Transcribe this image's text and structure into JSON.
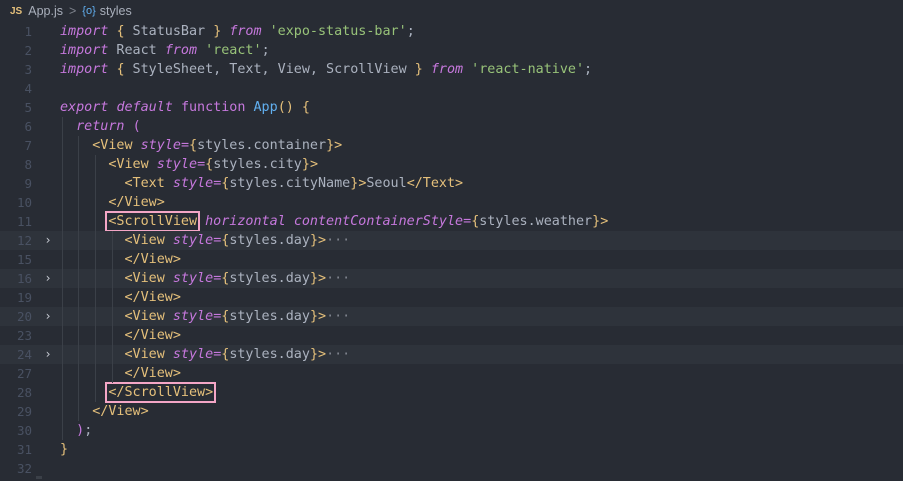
{
  "breadcrumb": {
    "lang_badge": "JS",
    "file": "App.js",
    "separator": ">",
    "symbol_icon": "{o}",
    "symbol": "styles"
  },
  "lines": [
    {
      "n": "1",
      "tokens": [
        [
          "kw",
          "import"
        ],
        [
          "plain",
          " "
        ],
        [
          "br2",
          "{"
        ],
        [
          "plain",
          " StatusBar "
        ],
        [
          "br2",
          "}"
        ],
        [
          "plain",
          " "
        ],
        [
          "kw",
          "from"
        ],
        [
          "plain",
          " "
        ],
        [
          "str",
          "'expo-status-bar'"
        ],
        [
          "plain",
          ";"
        ]
      ]
    },
    {
      "n": "2",
      "tokens": [
        [
          "kw",
          "import"
        ],
        [
          "plain",
          " React "
        ],
        [
          "kw",
          "from"
        ],
        [
          "plain",
          " "
        ],
        [
          "str",
          "'react'"
        ],
        [
          "plain",
          ";"
        ]
      ]
    },
    {
      "n": "3",
      "tokens": [
        [
          "kw",
          "import"
        ],
        [
          "plain",
          " "
        ],
        [
          "br2",
          "{"
        ],
        [
          "plain",
          " StyleSheet, Text, View, ScrollView "
        ],
        [
          "br2",
          "}"
        ],
        [
          "plain",
          " "
        ],
        [
          "kw",
          "from"
        ],
        [
          "plain",
          " "
        ],
        [
          "str",
          "'react-native'"
        ],
        [
          "plain",
          ";"
        ]
      ]
    },
    {
      "n": "4",
      "tokens": []
    },
    {
      "n": "5",
      "tokens": [
        [
          "kw",
          "export"
        ],
        [
          "plain",
          " "
        ],
        [
          "kw",
          "default"
        ],
        [
          "plain",
          " "
        ],
        [
          "brk",
          "function"
        ],
        [
          "plain",
          " "
        ],
        [
          "fn",
          "App"
        ],
        [
          "br2",
          "()"
        ],
        [
          "plain",
          " "
        ],
        [
          "br2",
          "{"
        ]
      ]
    },
    {
      "n": "6",
      "tokens": [
        [
          "plain",
          "  "
        ],
        [
          "kw",
          "return"
        ],
        [
          "plain",
          " "
        ],
        [
          "brk",
          "("
        ]
      ]
    },
    {
      "n": "7",
      "tokens": [
        [
          "plain",
          "    "
        ],
        [
          "tag",
          "<View"
        ],
        [
          "plain",
          " "
        ],
        [
          "attr",
          "style"
        ],
        [
          "brk",
          "="
        ],
        [
          "br2",
          "{"
        ],
        [
          "plain",
          "styles.container"
        ],
        [
          "br2",
          "}"
        ],
        [
          "tag",
          ">"
        ]
      ]
    },
    {
      "n": "8",
      "tokens": [
        [
          "plain",
          "      "
        ],
        [
          "tag",
          "<View"
        ],
        [
          "plain",
          " "
        ],
        [
          "attr",
          "style"
        ],
        [
          "brk",
          "="
        ],
        [
          "br2",
          "{"
        ],
        [
          "plain",
          "styles.city"
        ],
        [
          "br2",
          "}"
        ],
        [
          "tag",
          ">"
        ]
      ]
    },
    {
      "n": "9",
      "tokens": [
        [
          "plain",
          "        "
        ],
        [
          "tag",
          "<Text"
        ],
        [
          "plain",
          " "
        ],
        [
          "attr",
          "style"
        ],
        [
          "brk",
          "="
        ],
        [
          "br2",
          "{"
        ],
        [
          "plain",
          "styles.cityName"
        ],
        [
          "br2",
          "}"
        ],
        [
          "tag",
          ">"
        ],
        [
          "plain",
          "Seoul"
        ],
        [
          "tag",
          "</Text>"
        ]
      ]
    },
    {
      "n": "10",
      "tokens": [
        [
          "plain",
          "      "
        ],
        [
          "tag",
          "</View>"
        ]
      ]
    },
    {
      "n": "11",
      "tokens": [
        [
          "plain",
          "      "
        ],
        [
          "box",
          "<ScrollView"
        ],
        [
          "plain",
          " "
        ],
        [
          "attr",
          "horizontal"
        ],
        [
          "plain",
          " "
        ],
        [
          "attr",
          "contentContainerStyle"
        ],
        [
          "brk",
          "="
        ],
        [
          "br2",
          "{"
        ],
        [
          "plain",
          "styles.weather"
        ],
        [
          "br2",
          "}"
        ],
        [
          "tag",
          ">"
        ]
      ]
    },
    {
      "n": "12",
      "fold": true,
      "tokens": [
        [
          "plain",
          "        "
        ],
        [
          "tag",
          "<View"
        ],
        [
          "plain",
          " "
        ],
        [
          "attr",
          "style"
        ],
        [
          "brk",
          "="
        ],
        [
          "br2",
          "{"
        ],
        [
          "plain",
          "styles.day"
        ],
        [
          "br2",
          "}"
        ],
        [
          "tag",
          ">"
        ],
        [
          "ell",
          "···"
        ]
      ]
    },
    {
      "n": "15",
      "tokens": [
        [
          "plain",
          "        "
        ],
        [
          "tag",
          "</View>"
        ]
      ]
    },
    {
      "n": "16",
      "fold": true,
      "tokens": [
        [
          "plain",
          "        "
        ],
        [
          "tag",
          "<View"
        ],
        [
          "plain",
          " "
        ],
        [
          "attr",
          "style"
        ],
        [
          "brk",
          "="
        ],
        [
          "br2",
          "{"
        ],
        [
          "plain",
          "styles.day"
        ],
        [
          "br2",
          "}"
        ],
        [
          "tag",
          ">"
        ],
        [
          "ell",
          "···"
        ]
      ]
    },
    {
      "n": "19",
      "tokens": [
        [
          "plain",
          "        "
        ],
        [
          "tag",
          "</View>"
        ]
      ]
    },
    {
      "n": "20",
      "fold": true,
      "tokens": [
        [
          "plain",
          "        "
        ],
        [
          "tag",
          "<View"
        ],
        [
          "plain",
          " "
        ],
        [
          "attr",
          "style"
        ],
        [
          "brk",
          "="
        ],
        [
          "br2",
          "{"
        ],
        [
          "plain",
          "styles.day"
        ],
        [
          "br2",
          "}"
        ],
        [
          "tag",
          ">"
        ],
        [
          "ell",
          "···"
        ]
      ]
    },
    {
      "n": "23",
      "tokens": [
        [
          "plain",
          "        "
        ],
        [
          "tag",
          "</View>"
        ]
      ]
    },
    {
      "n": "24",
      "fold": true,
      "tokens": [
        [
          "plain",
          "        "
        ],
        [
          "tag",
          "<View"
        ],
        [
          "plain",
          " "
        ],
        [
          "attr",
          "style"
        ],
        [
          "brk",
          "="
        ],
        [
          "br2",
          "{"
        ],
        [
          "plain",
          "styles.day"
        ],
        [
          "br2",
          "}"
        ],
        [
          "tag",
          ">"
        ],
        [
          "ell",
          "···"
        ]
      ]
    },
    {
      "n": "27",
      "tokens": [
        [
          "plain",
          "        "
        ],
        [
          "tag",
          "</View>"
        ]
      ]
    },
    {
      "n": "28",
      "tokens": [
        [
          "plain",
          "      "
        ],
        [
          "box",
          "</ScrollView>"
        ]
      ]
    },
    {
      "n": "29",
      "tokens": [
        [
          "plain",
          "    "
        ],
        [
          "tag",
          "</View>"
        ]
      ]
    },
    {
      "n": "30",
      "tokens": [
        [
          "plain",
          "  "
        ],
        [
          "brk",
          ")"
        ],
        [
          "plain",
          ";"
        ]
      ]
    },
    {
      "n": "31",
      "tokens": [
        [
          "br2",
          "}"
        ]
      ]
    },
    {
      "n": "32",
      "tokens": []
    }
  ],
  "colors": {
    "background": "#282c34",
    "keyword": "#c678dd",
    "function": "#61afef",
    "string": "#98c379",
    "tag": "#e5c07b",
    "highlight_box": "#f4a6c6"
  }
}
